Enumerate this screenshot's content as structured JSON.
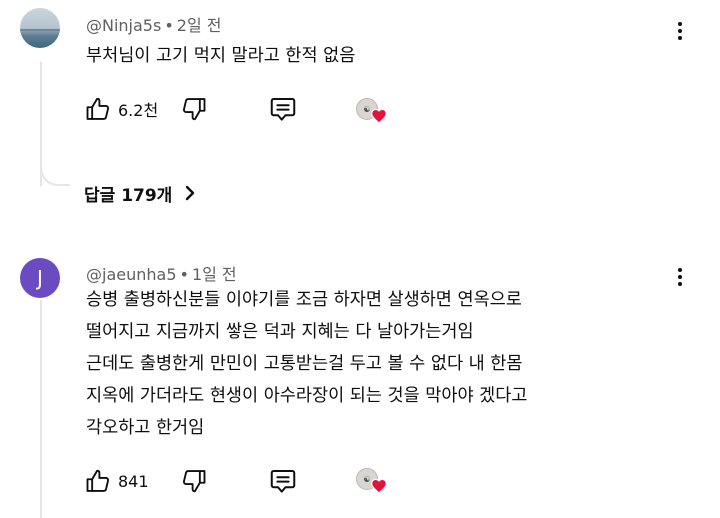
{
  "comments": [
    {
      "author": "@Ninja5s",
      "time": "2일 전",
      "avatar_type": "photo",
      "text_lines": [
        "부처님이 고기 먹지 말라고 한적 없음"
      ],
      "like_count": "6.2천",
      "replies_label": "답글 179개"
    },
    {
      "author": "@jaeunha5",
      "time": "1일 전",
      "avatar_letter": "J",
      "avatar_color": "#6a4bc2",
      "text_lines": [
        "승병 출병하신분들 이야기를 조금 하자면 살생하면 연옥으로",
        "떨어지고 지금까지 쌓은 덕과 지혜는 다 날아가는거임",
        "근데도 출병한게 만민이 고통받는걸 두고 볼 수 없다 내 한몸",
        "지옥에 가더라도 현생이 아수라장이 되는 것을 막아야 겠다고",
        "각오하고 한거임"
      ],
      "like_count": "841"
    }
  ],
  "icons": {
    "like": "thumbs-up-icon",
    "dislike": "thumbs-down-icon",
    "reply": "reply-comment-icon",
    "creator_heart": "creator-heart-icon",
    "more": "more-vertical-icon",
    "chevron": "chevron-right-icon"
  },
  "colors": {
    "heart": "#e4113b",
    "meta_text": "#606060",
    "thread_line": "#e5e5e5"
  }
}
